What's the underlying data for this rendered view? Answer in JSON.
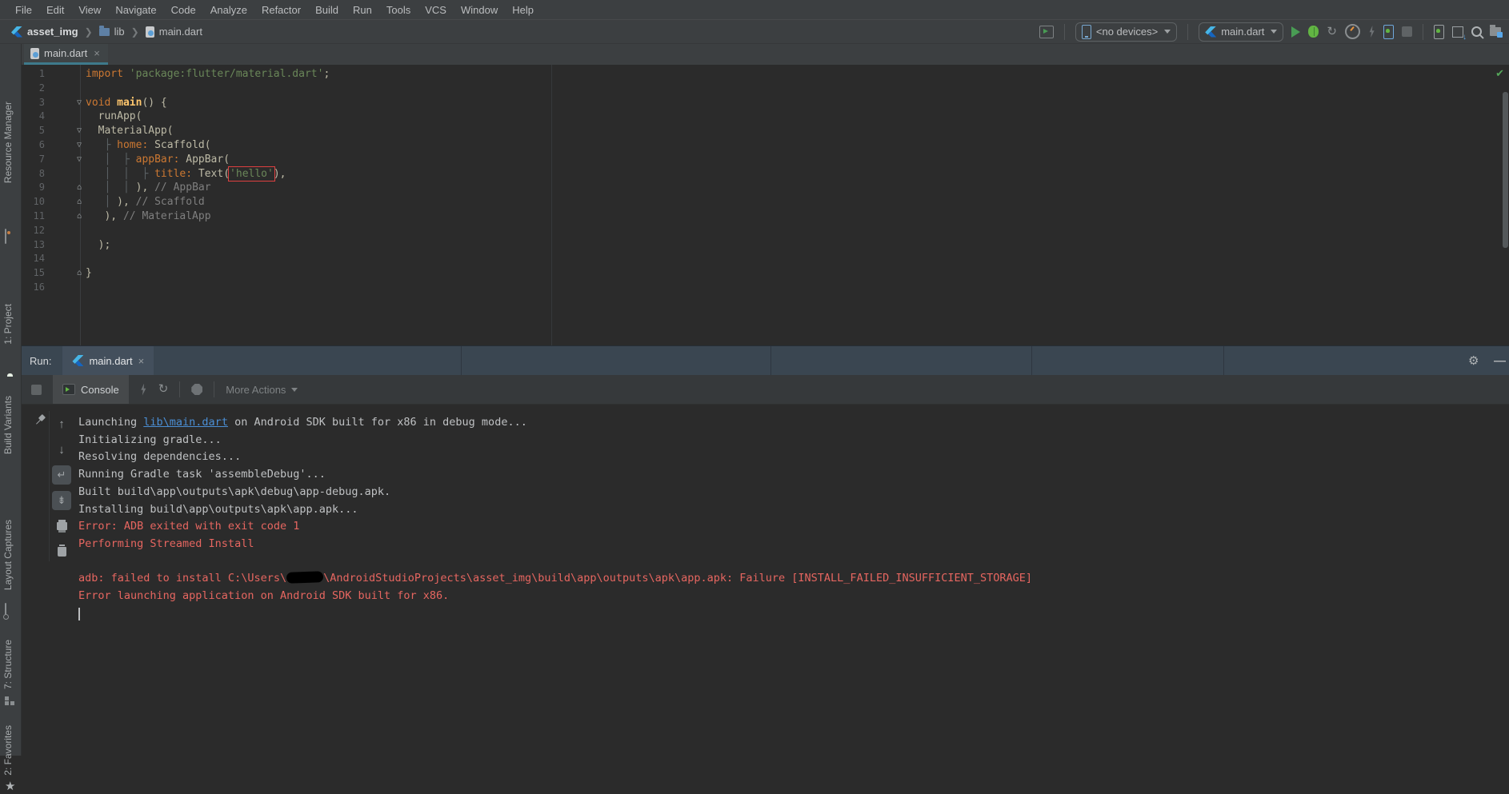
{
  "menu": {
    "items": [
      "File",
      "Edit",
      "View",
      "Navigate",
      "Code",
      "Analyze",
      "Refactor",
      "Build",
      "Run",
      "Tools",
      "VCS",
      "Window",
      "Help"
    ]
  },
  "breadcrumb": {
    "project": "asset_img",
    "folder": "lib",
    "file": "main.dart"
  },
  "toolbar": {
    "device_selector": "<no devices>",
    "run_config": "main.dart"
  },
  "editor_tab": {
    "label": "main.dart",
    "close": "×"
  },
  "editor": {
    "lines": [
      {
        "n": "1",
        "fold": "",
        "segs": [
          {
            "c": "kw",
            "t": "import "
          },
          {
            "c": "str",
            "t": "'package:flutter/material.dart'"
          },
          {
            "c": "pln",
            "t": ";"
          }
        ]
      },
      {
        "n": "2",
        "fold": "",
        "segs": []
      },
      {
        "n": "3",
        "fold": "down",
        "segs": [
          {
            "c": "kw",
            "t": "void "
          },
          {
            "c": "fn",
            "t": "main"
          },
          {
            "c": "pln",
            "t": "() {"
          }
        ]
      },
      {
        "n": "4",
        "fold": "",
        "segs": [
          {
            "c": "pln",
            "t": "  runApp("
          }
        ]
      },
      {
        "n": "5",
        "fold": "down",
        "segs": [
          {
            "c": "pln",
            "t": "  "
          },
          {
            "c": "cls",
            "t": "MaterialApp"
          },
          {
            "c": "pln",
            "t": "("
          }
        ]
      },
      {
        "n": "6",
        "fold": "down",
        "segs": [
          {
            "c": "pln",
            "t": "   "
          },
          {
            "c": "guide",
            "t": "├ "
          },
          {
            "c": "prm",
            "t": "home: "
          },
          {
            "c": "cls",
            "t": "Scaffold"
          },
          {
            "c": "pln",
            "t": "("
          }
        ]
      },
      {
        "n": "7",
        "fold": "down",
        "segs": [
          {
            "c": "pln",
            "t": "   "
          },
          {
            "c": "guide",
            "t": "│  ├ "
          },
          {
            "c": "prm",
            "t": "appBar: "
          },
          {
            "c": "cls",
            "t": "AppBar"
          },
          {
            "c": "pln",
            "t": "("
          }
        ]
      },
      {
        "n": "8",
        "fold": "",
        "segs": [
          {
            "c": "pln",
            "t": "   "
          },
          {
            "c": "guide",
            "t": "│  │  ├ "
          },
          {
            "c": "prm",
            "t": "title: "
          },
          {
            "c": "cls",
            "t": "Text"
          },
          {
            "c": "pln",
            "t": "("
          },
          {
            "c": "strbox",
            "t": "'hello'"
          },
          {
            "c": "pln",
            "t": "),"
          }
        ]
      },
      {
        "n": "9",
        "fold": "up",
        "segs": [
          {
            "c": "pln",
            "t": "   "
          },
          {
            "c": "guide",
            "t": "│  │ "
          },
          {
            "c": "pln",
            "t": "), "
          },
          {
            "c": "cmt",
            "t": "// AppBar"
          }
        ]
      },
      {
        "n": "10",
        "fold": "up",
        "segs": [
          {
            "c": "pln",
            "t": "   "
          },
          {
            "c": "guide",
            "t": "│ "
          },
          {
            "c": "pln",
            "t": "), "
          },
          {
            "c": "cmt",
            "t": "// Scaffold"
          }
        ]
      },
      {
        "n": "11",
        "fold": "up",
        "segs": [
          {
            "c": "pln",
            "t": "   "
          },
          {
            "c": "pln",
            "t": "), "
          },
          {
            "c": "cmt",
            "t": "// MaterialApp"
          }
        ]
      },
      {
        "n": "12",
        "fold": "",
        "segs": []
      },
      {
        "n": "13",
        "fold": "",
        "segs": [
          {
            "c": "pln",
            "t": "  );"
          }
        ]
      },
      {
        "n": "14",
        "fold": "",
        "segs": []
      },
      {
        "n": "15",
        "fold": "up",
        "segs": [
          {
            "c": "pln",
            "t": "}"
          }
        ]
      },
      {
        "n": "16",
        "fold": "",
        "segs": []
      }
    ]
  },
  "left_stripe": {
    "items": [
      {
        "label": "Resource Manager"
      },
      {
        "label": "1: Project"
      },
      {
        "label": "Build Variants"
      },
      {
        "label": "Layout Captures"
      },
      {
        "label": "7: Structure"
      },
      {
        "label": "2: Favorites"
      }
    ]
  },
  "run_panel": {
    "run_label": "Run:",
    "tab": "main.dart",
    "tab_close": "×",
    "console_tab": "Console",
    "more_actions": "More Actions",
    "gear": "⚙",
    "minimize": "—",
    "console_lines": [
      {
        "segs": [
          {
            "c": "pln",
            "t": "Launching "
          },
          {
            "c": "link",
            "t": "lib\\main.dart"
          },
          {
            "c": "pln",
            "t": " on Android SDK built for x86 in debug mode..."
          }
        ]
      },
      {
        "segs": [
          {
            "c": "pln",
            "t": "Initializing gradle..."
          }
        ]
      },
      {
        "segs": [
          {
            "c": "pln",
            "t": "Resolving dependencies..."
          }
        ]
      },
      {
        "segs": [
          {
            "c": "pln",
            "t": "Running Gradle task 'assembleDebug'..."
          }
        ]
      },
      {
        "segs": [
          {
            "c": "pln",
            "t": "Built build\\app\\outputs\\apk\\debug\\app-debug.apk."
          }
        ]
      },
      {
        "segs": [
          {
            "c": "pln",
            "t": "Installing build\\app\\outputs\\apk\\app.apk..."
          }
        ]
      },
      {
        "segs": [
          {
            "c": "err",
            "t": "Error: ADB exited with exit code 1"
          }
        ]
      },
      {
        "segs": [
          {
            "c": "err",
            "t": "Performing Streamed Install"
          }
        ]
      },
      {
        "segs": []
      },
      {
        "segs": [
          {
            "c": "err",
            "t": "adb: failed to install C:\\Users\\"
          },
          {
            "c": "redact",
            "t": ""
          },
          {
            "c": "err",
            "t": "\\AndroidStudioProjects\\asset_img\\build\\app\\outputs\\apk\\app.apk: Failure [INSTALL_FAILED_INSUFFICIENT_STORAGE]"
          }
        ]
      },
      {
        "segs": [
          {
            "c": "err",
            "t": "Error launching application on Android SDK built for x86."
          }
        ]
      }
    ]
  },
  "colors": {
    "chrome": "#3C3F41",
    "editor_bg": "#2B2B2B",
    "run_header": "#3A4651",
    "keyword": "#CC7832",
    "string": "#6A8759",
    "comment": "#7F7F7F",
    "error_red": "#E66660",
    "link_blue": "#4B8FD5",
    "tab_underline": "#3E7A8C",
    "run_green": "#499C54",
    "check_green": "#55A85A",
    "highlight_box_red": "#DE4040"
  }
}
